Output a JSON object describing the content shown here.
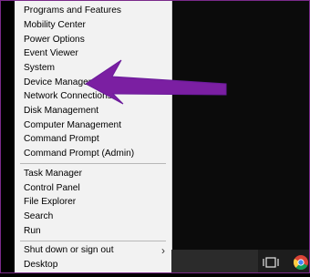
{
  "menu": {
    "group1": [
      {
        "label": "Programs and Features"
      },
      {
        "label": "Mobility Center"
      },
      {
        "label": "Power Options"
      },
      {
        "label": "Event Viewer"
      },
      {
        "label": "System"
      },
      {
        "label": "Device Manager"
      },
      {
        "label": "Network Connections"
      },
      {
        "label": "Disk Management"
      },
      {
        "label": "Computer Management"
      },
      {
        "label": "Command Prompt"
      },
      {
        "label": "Command Prompt (Admin)"
      }
    ],
    "group2": [
      {
        "label": "Task Manager"
      },
      {
        "label": "Control Panel"
      },
      {
        "label": "File Explorer"
      },
      {
        "label": "Search"
      },
      {
        "label": "Run"
      }
    ],
    "group3": [
      {
        "label": "Shut down or sign out",
        "submenu_glyph": "›"
      },
      {
        "label": "Desktop"
      }
    ]
  },
  "annotation": {
    "arrow_color": "#7b1fa2",
    "points_to": "Device Manager"
  },
  "taskbar": {
    "icons": [
      {
        "name": "task-view-icon"
      },
      {
        "name": "chrome-icon"
      }
    ]
  }
}
